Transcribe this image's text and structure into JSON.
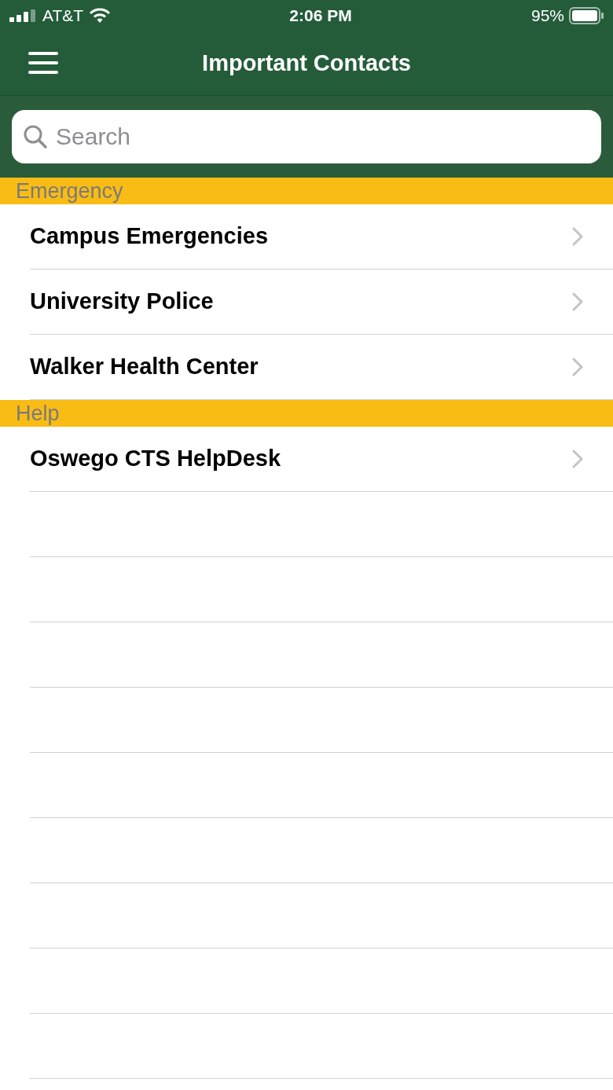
{
  "status_bar": {
    "carrier": "AT&T",
    "time": "2:06 PM",
    "battery": "95%"
  },
  "nav_bar": {
    "title": "Important Contacts"
  },
  "search": {
    "placeholder": "Search"
  },
  "sections": [
    {
      "title": "Emergency",
      "rows": [
        {
          "label": "Campus Emergencies"
        },
        {
          "label": "University Police"
        },
        {
          "label": "Walker Health Center"
        }
      ]
    },
    {
      "title": "Help",
      "rows": [
        {
          "label": "Oswego CTS HelpDesk"
        }
      ]
    }
  ]
}
